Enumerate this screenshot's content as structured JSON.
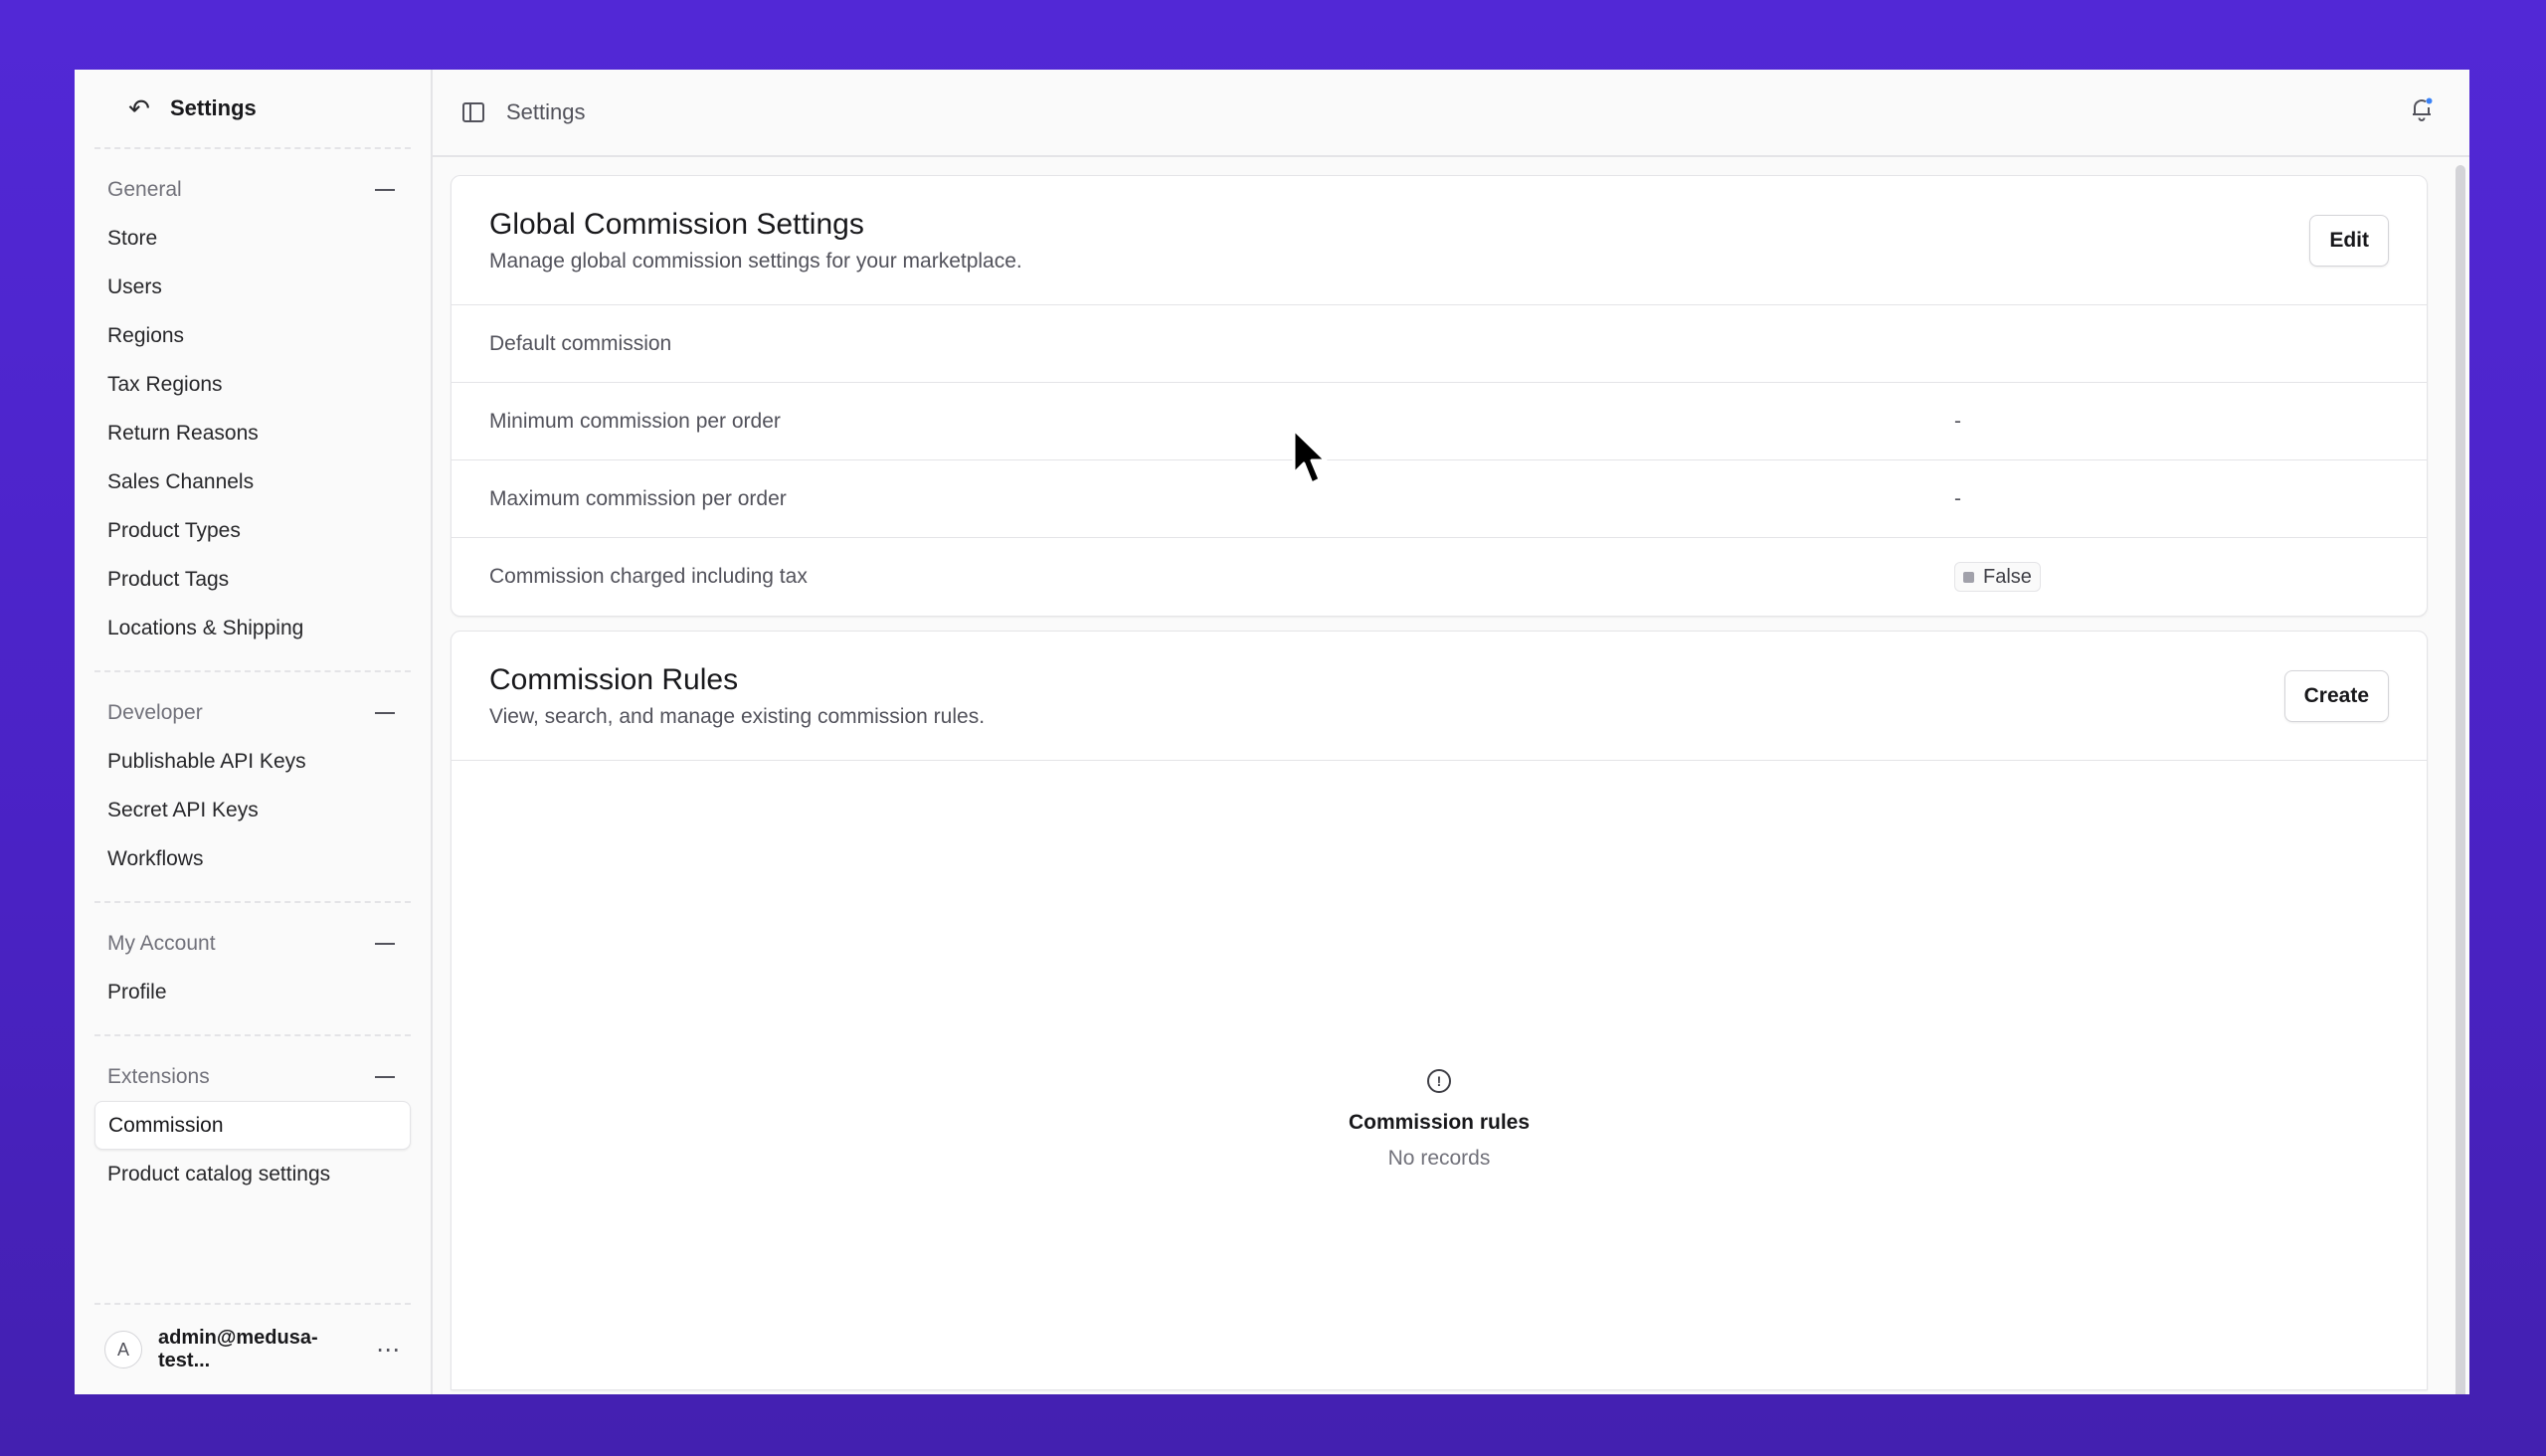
{
  "sidebar": {
    "title": "Settings",
    "sections": [
      {
        "label": "General",
        "items": [
          "Store",
          "Users",
          "Regions",
          "Tax Regions",
          "Return Reasons",
          "Sales Channels",
          "Product Types",
          "Product Tags",
          "Locations & Shipping"
        ]
      },
      {
        "label": "Developer",
        "items": [
          "Publishable API Keys",
          "Secret API Keys",
          "Workflows"
        ]
      },
      {
        "label": "My Account",
        "items": [
          "Profile"
        ]
      },
      {
        "label": "Extensions",
        "items": [
          "Commission",
          "Product catalog settings"
        ]
      }
    ],
    "user": {
      "initial": "A",
      "email": "admin@medusa-test..."
    }
  },
  "topbar": {
    "breadcrumb": "Settings"
  },
  "global": {
    "title": "Global Commission Settings",
    "subtitle": "Manage global commission settings for your marketplace.",
    "edit_label": "Edit",
    "rows": [
      {
        "label": "Default commission",
        "value": ""
      },
      {
        "label": "Minimum commission per order",
        "value": "-"
      },
      {
        "label": "Maximum commission per order",
        "value": "-"
      },
      {
        "label": "Commission charged including tax",
        "value": "False"
      }
    ]
  },
  "rules": {
    "title": "Commission Rules",
    "subtitle": "View, search, and manage existing commission rules.",
    "create_label": "Create",
    "empty_title": "Commission rules",
    "empty_sub": "No records"
  }
}
